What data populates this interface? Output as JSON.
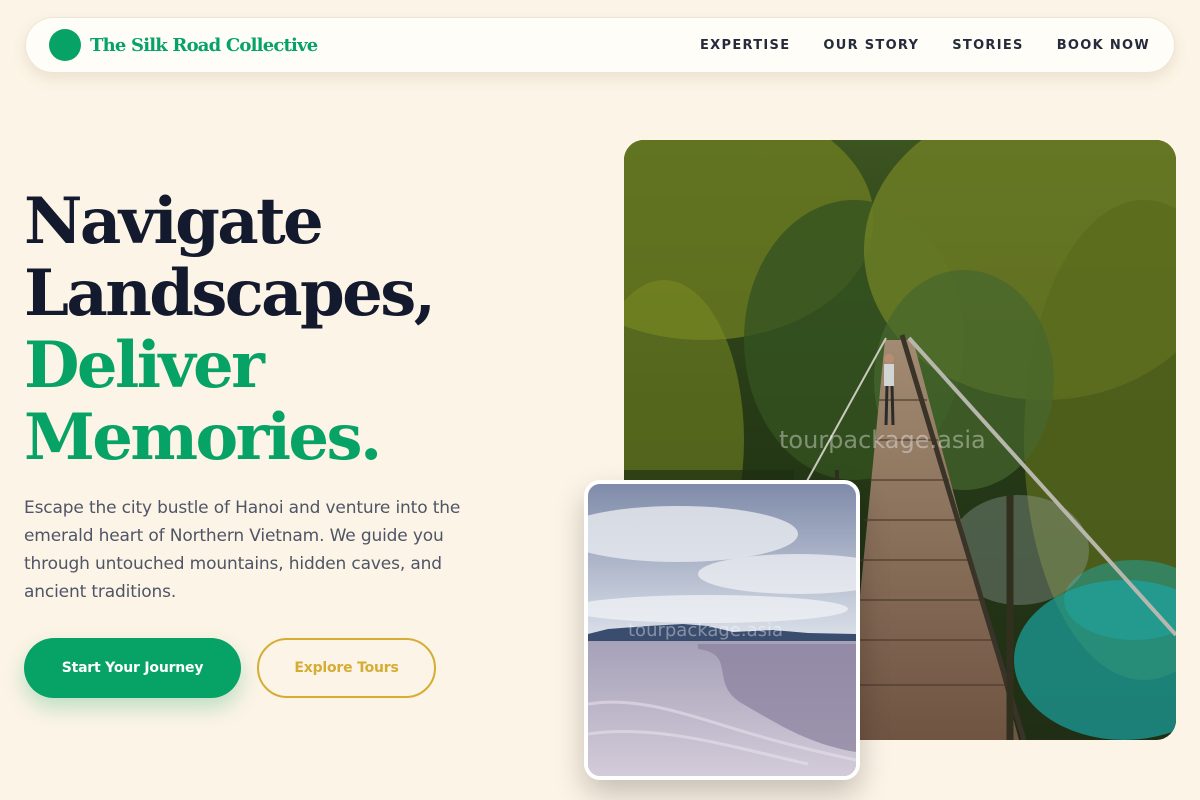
{
  "colors": {
    "accent": "#07a366",
    "gold": "#d6ad34",
    "background": "#fcf4e6",
    "headline_dark": "#141a2e"
  },
  "header": {
    "logo_icon": "green-circle-logo",
    "brand_name": "The Silk Road Collective",
    "nav": [
      "EXPERTISE",
      "OUR STORY",
      "STORIES",
      "BOOK NOW"
    ]
  },
  "hero": {
    "headline": {
      "line1": "Navigate",
      "line2": "Landscapes,",
      "line3": "Deliver",
      "line4": "Memories."
    },
    "intro": "Escape the city bustle of Hanoi and venture into the emerald heart of Northern Vietnam. We guide you through untouched mountains, hidden caves, and ancient traditions.",
    "primary_button": "Start Your Journey",
    "secondary_button": "Explore Tours"
  },
  "images": {
    "main_watermark": "tourpackage.asia",
    "side_watermark": "tourpackage.asia"
  }
}
